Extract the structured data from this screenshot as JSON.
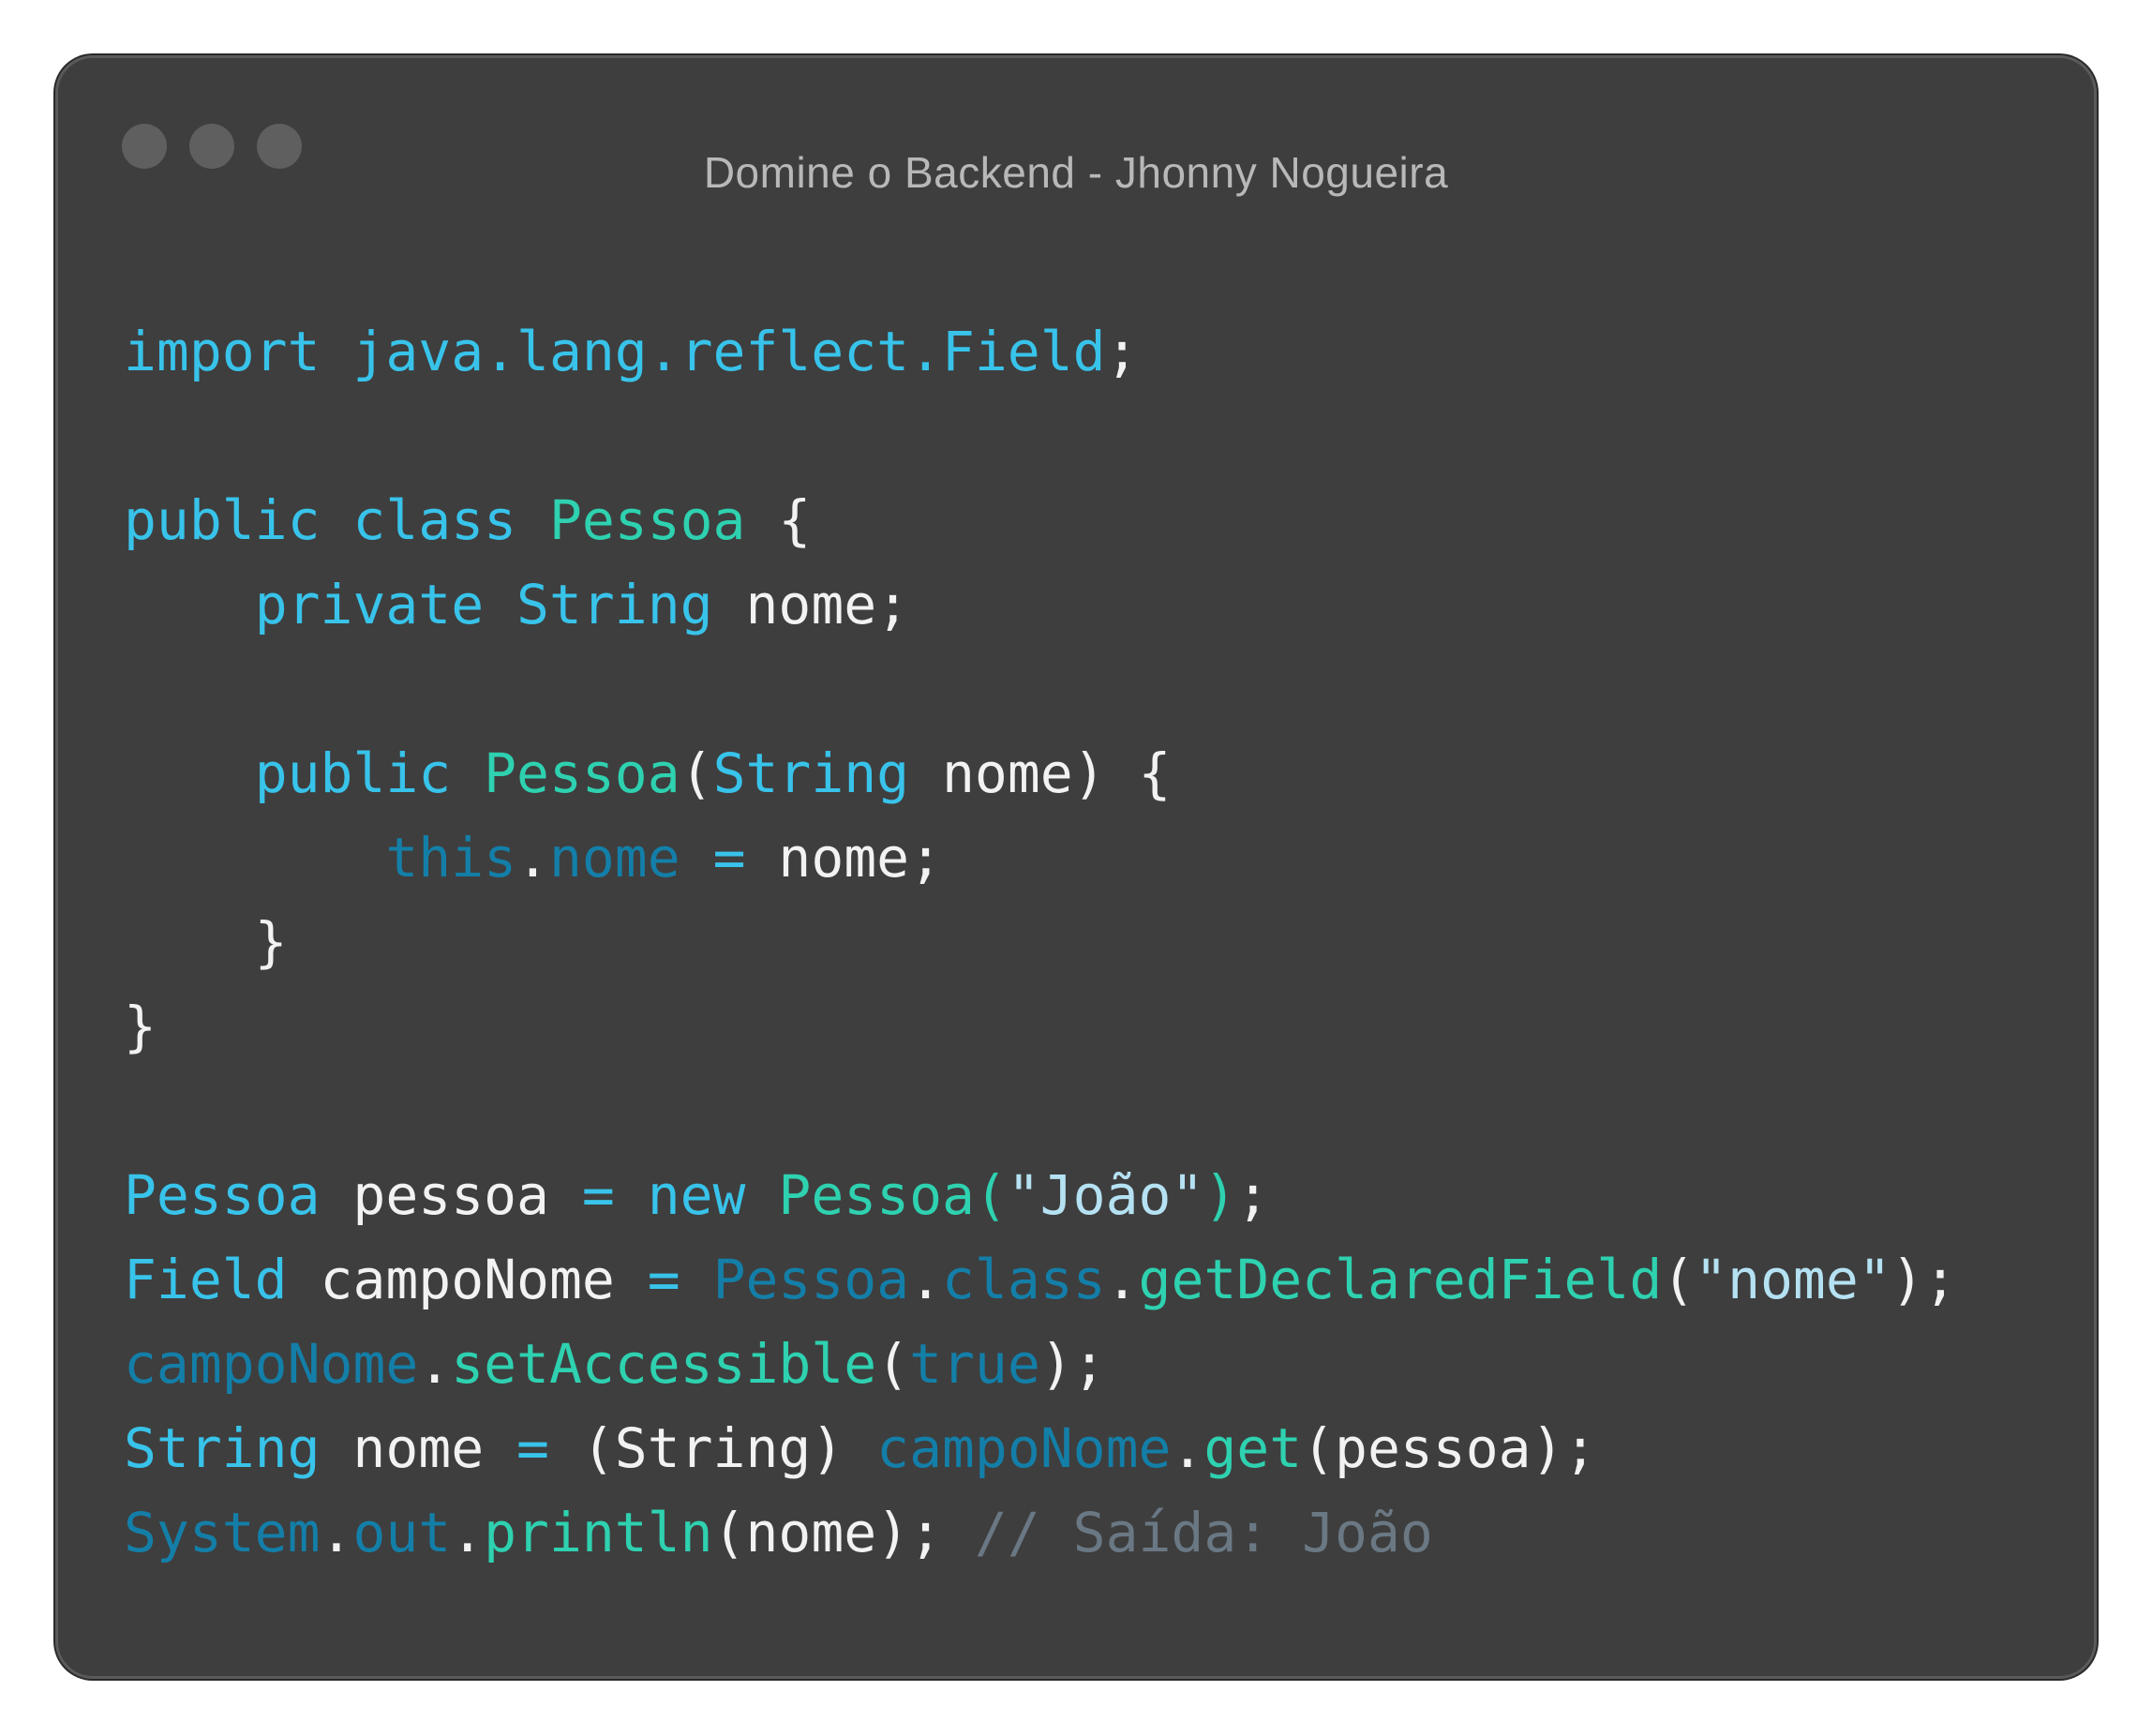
{
  "window": {
    "title": "Domine o Backend - Jhonny Nogueira"
  },
  "code_lines": [
    [
      {
        "t": "import java.lang.reflect.Field",
        "c": "kw"
      },
      {
        "t": ";",
        "c": "pl"
      }
    ],
    [],
    [
      {
        "t": "public class ",
        "c": "kw"
      },
      {
        "t": "Pessoa",
        "c": "ty"
      },
      {
        "t": " {",
        "c": "pl"
      }
    ],
    [
      {
        "t": "    ",
        "c": "pl"
      },
      {
        "t": "private ",
        "c": "kw"
      },
      {
        "t": "String",
        "c": "kw"
      },
      {
        "t": " nome;",
        "c": "pl"
      }
    ],
    [],
    [
      {
        "t": "    ",
        "c": "pl"
      },
      {
        "t": "public ",
        "c": "kw"
      },
      {
        "t": "Pessoa",
        "c": "ty"
      },
      {
        "t": "(",
        "c": "pl"
      },
      {
        "t": "String",
        "c": "kw"
      },
      {
        "t": " nome) {",
        "c": "pl"
      }
    ],
    [
      {
        "t": "        ",
        "c": "pl"
      },
      {
        "t": "this",
        "c": "mb"
      },
      {
        "t": ".",
        "c": "pl"
      },
      {
        "t": "nome",
        "c": "mb"
      },
      {
        "t": " = ",
        "c": "kw"
      },
      {
        "t": "nome;",
        "c": "pl"
      }
    ],
    [
      {
        "t": "    }",
        "c": "pl"
      }
    ],
    [
      {
        "t": "}",
        "c": "pl"
      }
    ],
    [],
    [
      {
        "t": "Pessoa",
        "c": "kw"
      },
      {
        "t": " pessoa ",
        "c": "pl"
      },
      {
        "t": "= ",
        "c": "kw"
      },
      {
        "t": "new ",
        "c": "kw"
      },
      {
        "t": "Pessoa(",
        "c": "ty"
      },
      {
        "t": "\"João\"",
        "c": "str"
      },
      {
        "t": ")",
        "c": "ty"
      },
      {
        "t": ";",
        "c": "pl"
      }
    ],
    [
      {
        "t": "Field",
        "c": "kw"
      },
      {
        "t": " campoNome ",
        "c": "pl"
      },
      {
        "t": "= ",
        "c": "kw"
      },
      {
        "t": "Pessoa",
        "c": "mb"
      },
      {
        "t": ".",
        "c": "pl"
      },
      {
        "t": "class",
        "c": "mb"
      },
      {
        "t": ".",
        "c": "pl"
      },
      {
        "t": "getDeclaredField",
        "c": "fn"
      },
      {
        "t": "(",
        "c": "pl"
      },
      {
        "t": "\"nome\"",
        "c": "str"
      },
      {
        "t": ");",
        "c": "pl"
      }
    ],
    [
      {
        "t": "campoNome",
        "c": "mb"
      },
      {
        "t": ".",
        "c": "pl"
      },
      {
        "t": "setAccessible",
        "c": "fn"
      },
      {
        "t": "(",
        "c": "pl"
      },
      {
        "t": "true",
        "c": "mb"
      },
      {
        "t": ");",
        "c": "pl"
      }
    ],
    [
      {
        "t": "String",
        "c": "kw"
      },
      {
        "t": " nome ",
        "c": "pl"
      },
      {
        "t": "= ",
        "c": "kw"
      },
      {
        "t": "(String) ",
        "c": "pl"
      },
      {
        "t": "campoNome",
        "c": "mb"
      },
      {
        "t": ".",
        "c": "pl"
      },
      {
        "t": "get",
        "c": "fn"
      },
      {
        "t": "(pessoa);",
        "c": "pl"
      }
    ],
    [
      {
        "t": "System",
        "c": "mb"
      },
      {
        "t": ".",
        "c": "pl"
      },
      {
        "t": "out",
        "c": "mb"
      },
      {
        "t": ".",
        "c": "pl"
      },
      {
        "t": "println",
        "c": "fn"
      },
      {
        "t": "(nome); ",
        "c": "pl"
      },
      {
        "t": "// Saída: João",
        "c": "cm"
      }
    ]
  ]
}
